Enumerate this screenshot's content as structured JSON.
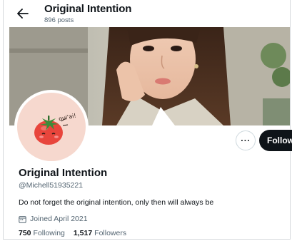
{
  "header": {
    "title": "Original Intention",
    "post_count": "896 posts",
    "back_icon": "arrow-left-icon"
  },
  "avatar": {
    "sticker_text": "oui'ai!"
  },
  "actions": {
    "more_icon": "ellipsis-icon",
    "more_label": "···",
    "follow_label": "Follow"
  },
  "profile": {
    "display_name": "Original Intention",
    "handle": "@Michell51935221",
    "bio": "Do not forget the original intention, only then will always be",
    "joined": "Joined April 2021",
    "calendar_icon": "calendar-icon"
  },
  "stats": {
    "following_count": "750",
    "following_label": "Following",
    "followers_count": "1,517",
    "followers_label": "Followers"
  },
  "colors": {
    "text_primary": "#0f1419",
    "text_secondary": "#536471",
    "follow_button": "#0f1419",
    "avatar_bg": "#f6d8ce",
    "tomato_red": "#e8453c"
  }
}
